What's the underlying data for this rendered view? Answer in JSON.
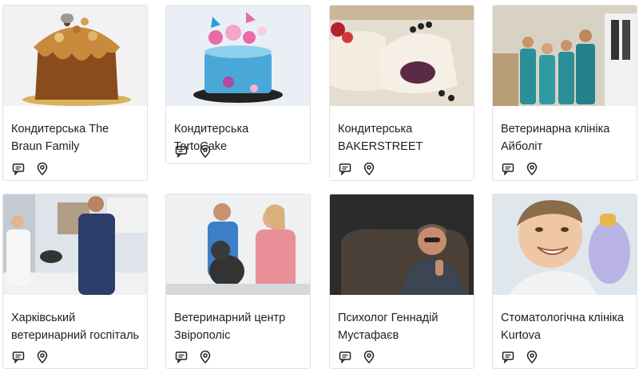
{
  "cards": [
    {
      "title": "Кондитерська The Braun Family",
      "image": "chocolate-kulich-cake",
      "colors": [
        "#f2f2f2",
        "#8a4b1e",
        "#c98a3c",
        "#d8b25c"
      ]
    },
    {
      "title": "Кондитерська TortoCake",
      "image": "blue-butterfly-cake",
      "colors": [
        "#e9eff4",
        "#4aa8d8",
        "#e86aa8",
        "#222"
      ]
    },
    {
      "title": "Кондитерська BAKERSTREET",
      "image": "meringue-rolls-berries",
      "colors": [
        "#e5ddd0",
        "#f4ece1",
        "#b8202a",
        "#222"
      ]
    },
    {
      "title": "Ветеринарна клініка Айболіт",
      "image": "vet-clinic-team",
      "colors": [
        "#d8d2c4",
        "#2a8f98",
        "#b79d76",
        "#f1f1f1"
      ]
    },
    {
      "title": "Харківський ветеринарний госпіталь",
      "image": "vet-with-dog",
      "colors": [
        "#dfe4ea",
        "#2c3d6b",
        "#b09e86",
        "#f1f1f1"
      ]
    },
    {
      "title": "Ветеринарний центр Звірополіс",
      "image": "vets-with-french-bulldog",
      "colors": [
        "#eef0f2",
        "#3c7fc6",
        "#e98f97",
        "#333"
      ]
    },
    {
      "title": "Психолог Геннадій Мустафаєв",
      "image": "psychologist-portrait",
      "colors": [
        "#2b2b2b",
        "#4a4038",
        "#c58d6d",
        "#111"
      ]
    },
    {
      "title": "Стоматологічна клініка Kurtova",
      "image": "smiling-child-with-toy",
      "colors": [
        "#dfe6ec",
        "#f0c7a4",
        "#b9b3e6",
        "#8a6c4d"
      ]
    }
  ],
  "icons": {
    "review": "comment-icon",
    "location": "location-pin-icon"
  }
}
